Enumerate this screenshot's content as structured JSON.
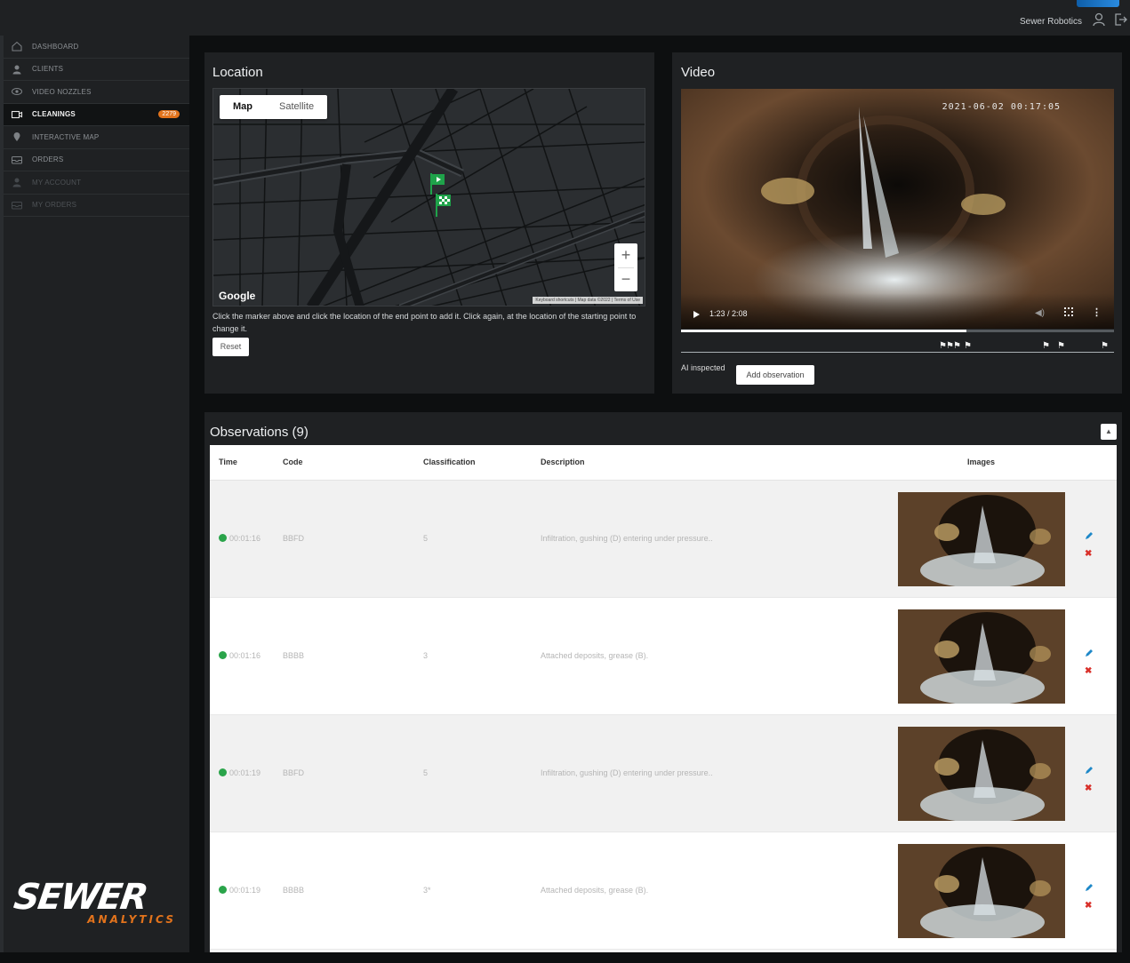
{
  "topbar": {
    "user_name": "Sewer Robotics"
  },
  "sidebar": {
    "items": [
      {
        "label": "Dashboard"
      },
      {
        "label": "Clients"
      },
      {
        "label": "Video nozzles"
      },
      {
        "label": "Cleanings",
        "badge": "2279"
      },
      {
        "label": "Interactive map"
      },
      {
        "label": "Orders"
      },
      {
        "label": "My account"
      },
      {
        "label": "My orders"
      }
    ],
    "brand": {
      "main": "SEWER",
      "sub": "ANALYTICS"
    }
  },
  "location": {
    "title": "Location",
    "map_type_options": [
      "Map",
      "Satellite"
    ],
    "selected_map_type": "Map",
    "zoom_in": "+",
    "zoom_out": "−",
    "google_mark": "Google",
    "attribution": "Keyboard shortcuts | Map data ©2022 | Terms of Use",
    "hint": "Click the marker above and click the location of the end point to add it. Click again, at the location of the starting point to change it.",
    "reset_label": "Reset"
  },
  "video": {
    "title": "Video",
    "timestamp": "2021-06-02 00:17:05",
    "time_display": "1:23 / 2:08",
    "progress": 0.66,
    "ai_label": "AI inspected",
    "add_observation_label": "Add observation"
  },
  "observations": {
    "title": "Observations (9)",
    "columns": [
      "Time",
      "Code",
      "Classification",
      "Description",
      "Images"
    ],
    "rows": [
      {
        "time": "00:01:16",
        "code": "BBFD",
        "classification": "5",
        "description": "Infiltration, gushing (D) entering under pressure.."
      },
      {
        "time": "00:01:16",
        "code": "BBBB",
        "classification": "3",
        "description": "Attached deposits, grease (B)."
      },
      {
        "time": "00:01:19",
        "code": "BBFD",
        "classification": "5",
        "description": "Infiltration, gushing (D) entering under pressure.."
      },
      {
        "time": "00:01:19",
        "code": "BBBB",
        "classification": "3*",
        "description": "Attached deposits, grease (B)."
      }
    ]
  },
  "colors": {
    "accent": "#e2731c",
    "status_ok": "#2aa44a",
    "delete": "#d9302a",
    "edit": "#1e88c8"
  }
}
